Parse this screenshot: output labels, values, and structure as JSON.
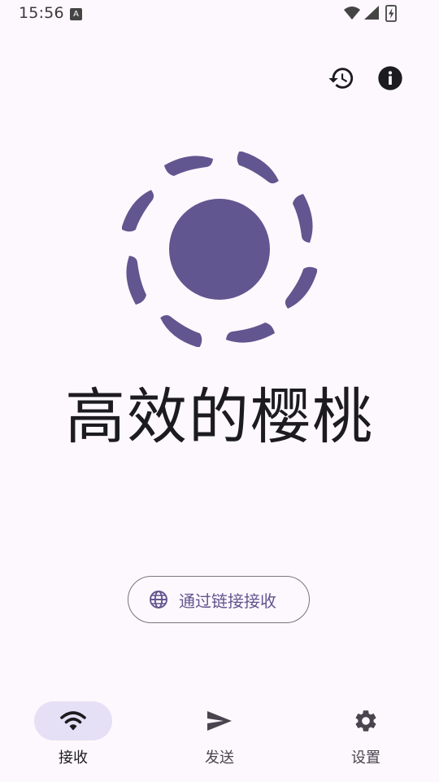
{
  "status_bar": {
    "time": "15:56",
    "notification_icon": "text-a-icon",
    "notification_letter": "A",
    "icons": [
      "wifi-icon",
      "cell-signal-icon",
      "battery-charging-icon"
    ]
  },
  "top_actions": {
    "history_icon": "history-icon",
    "info_icon": "info-icon"
  },
  "colors": {
    "accent": "#625690",
    "background": "#fdf8fd",
    "nav_active_pill": "#e6e0f6"
  },
  "main": {
    "logo_icon": "app-logo-icon",
    "title": "高效的樱桃",
    "receive_link_button": {
      "icon": "globe-icon",
      "label": "通过链接接收"
    }
  },
  "bottom_nav": {
    "items": [
      {
        "label": "接收",
        "icon": "wifi-icon",
        "active": true
      },
      {
        "label": "发送",
        "icon": "send-icon",
        "active": false
      },
      {
        "label": "设置",
        "icon": "gear-icon",
        "active": false
      }
    ]
  }
}
